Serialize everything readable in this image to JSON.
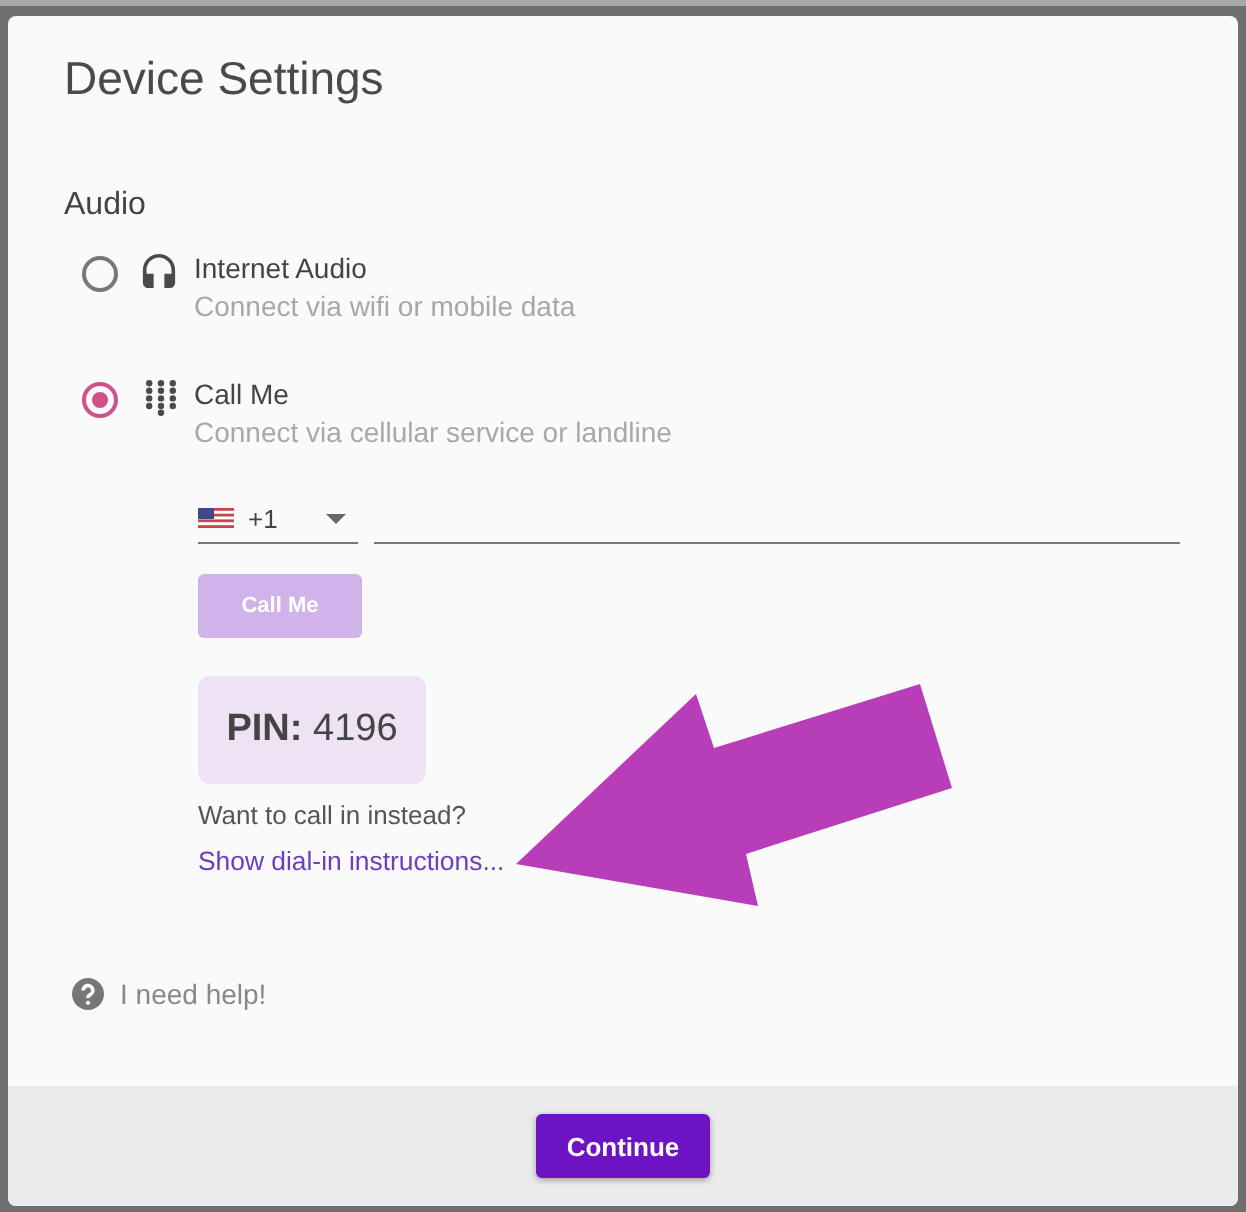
{
  "dialog": {
    "title": "Device Settings"
  },
  "audio": {
    "heading": "Audio",
    "options": [
      {
        "kind": "internet",
        "label": "Internet Audio",
        "description": "Connect via wifi or mobile data",
        "selected": false
      },
      {
        "kind": "phone",
        "label": "Call Me",
        "description": "Connect via cellular service or landline",
        "selected": true
      }
    ]
  },
  "call_me": {
    "country_code": "+1",
    "button": {
      "label": "Call Me",
      "disabled": true
    },
    "pin": "**PIN:** 4196",
    "prompt": "Want to call in instead?",
    "dial_in_link": "Show dial-in instructions..."
  },
  "help_link": "I need help!",
  "footer": {
    "buttons": [
      {
        "label": "Continue",
        "primary": true
      }
    ]
  }
}
